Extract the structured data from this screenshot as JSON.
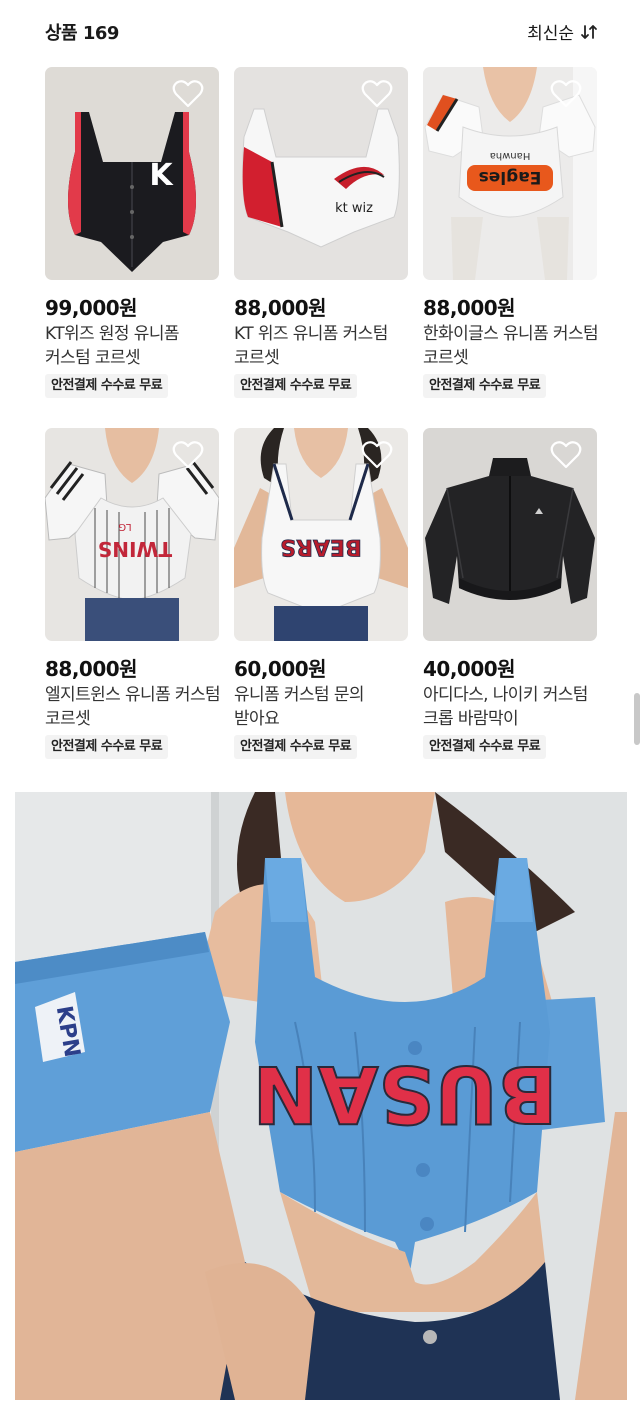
{
  "header": {
    "count_label": "상품 169",
    "sort_label": "최신순"
  },
  "products": [
    {
      "price": "99,000원",
      "title": "KT위즈 원정 유니폼 커스텀 코르셋",
      "badge": "안전결제 수수료 무료"
    },
    {
      "price": "88,000원",
      "title": "KT 위즈 유니폼 커스텀 코르셋",
      "badge": "안전결제 수수료 무료"
    },
    {
      "price": "88,000원",
      "title": "한화이글스 유니폼 커스텀 코르셋",
      "badge": "안전결제 수수료 무료"
    },
    {
      "price": "88,000원",
      "title": "엘지트윈스 유니폼 커스텀 코르셋",
      "badge": "안전결제 수수료 무료"
    },
    {
      "price": "60,000원",
      "title": "유니폼 커스텀 문의 받아요",
      "badge": "안전결제 수수료 무료"
    },
    {
      "price": "40,000원",
      "title": "아디다스, 나이키 커스텀 크롭 바람막이",
      "badge": "안전결제 수수료 무료"
    }
  ],
  "image_text": {
    "p1_logo": "K",
    "p2_logo": "kt wiz",
    "p3_brand": "Hanwha",
    "p3_team": "Eagles",
    "p4_team": "TWINS",
    "p4_small": "LG",
    "p5_team": "BEARS",
    "hero_team": "BUSAN",
    "hero_sleeve": "KPN"
  },
  "colors": {
    "heart_outline": "#ffffff",
    "badge_bg": "#f3f3f3",
    "hero_jersey": "#5a9bd5",
    "hero_lettering": "#e03048"
  }
}
